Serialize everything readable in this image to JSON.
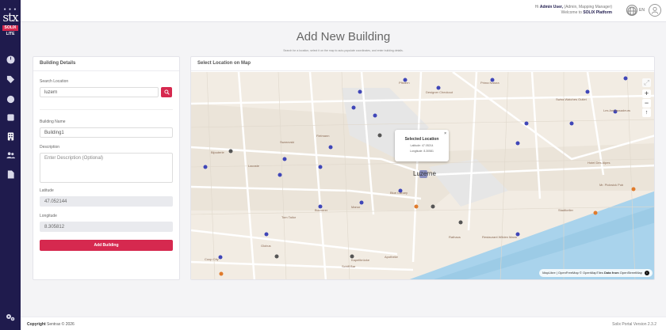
{
  "brand": {
    "name": "stx",
    "badge": "SOLIX",
    "edition": "LITE"
  },
  "topbar": {
    "welcome_prefix": "Hi ",
    "user_name": "Admin User,",
    "role": " (Admin, Mapping Manager)",
    "welcome_line2_prefix": "Welcome to ",
    "platform": "SOLIX Platform",
    "language": "EN"
  },
  "page": {
    "title": "Add New Building",
    "subtitle": "Search for a location, select it on the map to auto-populate coordinates, and enter building details."
  },
  "details_card": {
    "heading": "Building Details",
    "search_label": "Search Location",
    "search_value": "luzern",
    "name_label": "Building Name",
    "name_value": "Building1",
    "description_label": "Description",
    "description_placeholder": "Enter Description (Optional)",
    "latitude_label": "Latitude",
    "latitude_value": "47.052144",
    "longitude_label": "Longitude",
    "longitude_value": "8.305812",
    "submit_label": "Add Building"
  },
  "map_card": {
    "heading": "Select Location on Map",
    "popup_title": "Selected Location",
    "popup_lat": "Latitude: 47.05214",
    "popup_lng": "Longitude: 8.30581",
    "city_label": "Luzerne",
    "zoom_in": "+",
    "zoom_out": "−",
    "attribution_prefix": "MapLibre | OpenFreeMap © OpenMapTiles ",
    "attribution_bold": "Data from",
    "attribution_suffix": " OpenStreetMap",
    "places": [
      {
        "label": "Hotel Des Alpes"
      },
      {
        "label": "Mr. Pickwick Pub"
      },
      {
        "label": "Swiss Watches Outlet"
      },
      {
        "label": "Les Ambassadeurs"
      },
      {
        "label": "Designer Checkout"
      },
      {
        "label": "Stadtkeller"
      },
      {
        "label": "Restaurant Wilden Mann"
      },
      {
        "label": "Rathaus"
      },
      {
        "label": "Blue Canary"
      },
      {
        "label": "Manor"
      },
      {
        "label": "Bucherer"
      },
      {
        "label": "Tom Tailor"
      },
      {
        "label": "Lacoste"
      },
      {
        "label": "Swarovski"
      },
      {
        "label": "Fielmann"
      },
      {
        "label": "Bijouterie"
      },
      {
        "label": "Globus"
      },
      {
        "label": "Coop City"
      },
      {
        "label": "Pfistern"
      },
      {
        "label": "Schiff Bar"
      },
      {
        "label": "Kapellbrücke"
      },
      {
        "label": "Apotheke"
      }
    ]
  },
  "footer": {
    "copyright_prefix": "Copyright ",
    "copyright_rest": "Sentrax © 2026",
    "version": "Solix Portal Version 2.3.2"
  },
  "colors": {
    "sidebar": "#1f1b4d",
    "accent": "#d6294f",
    "water": "#a9d3ec",
    "map_land": "#f2ece3"
  }
}
